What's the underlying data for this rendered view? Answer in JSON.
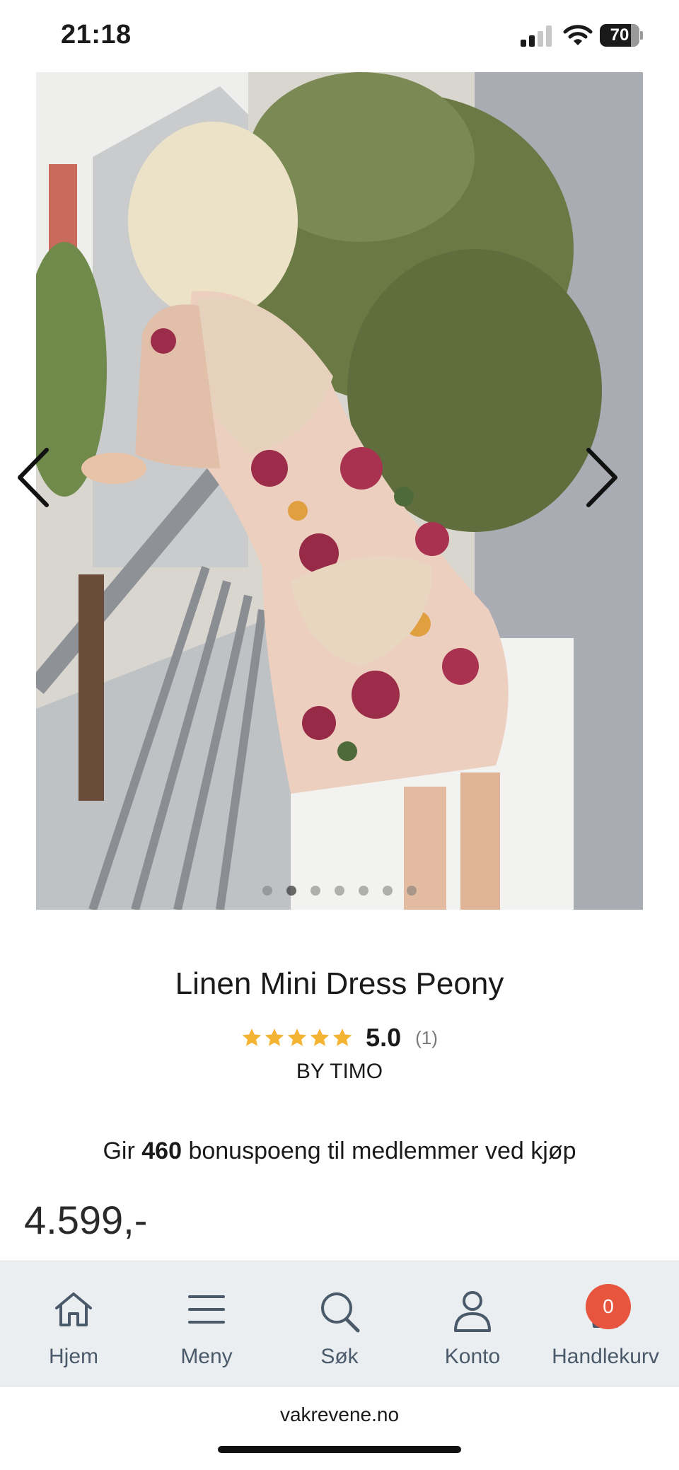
{
  "status_bar": {
    "time": "21:18",
    "battery": "70",
    "signal_bars_active": 2
  },
  "gallery": {
    "image_alt": "Linen Mini Dress Peony",
    "dot_count": 7,
    "active_dot": 1
  },
  "product": {
    "title": "Linen Mini Dress Peony",
    "rating": "5.0",
    "rating_count": "(1)",
    "stars": 5,
    "brand": "BY TIMO",
    "bonus_prefix": "Gir ",
    "bonus_points": "460",
    "bonus_suffix": " bonuspoeng til medlemmer ved kjøp",
    "price": "4.599,-"
  },
  "bottom_nav": {
    "items": [
      {
        "label": "Hjem",
        "icon": "home-icon"
      },
      {
        "label": "Meny",
        "icon": "menu-icon"
      },
      {
        "label": "Søk",
        "icon": "search-icon"
      },
      {
        "label": "Konto",
        "icon": "user-icon"
      },
      {
        "label": "Handlekurv",
        "icon": "cart-icon"
      }
    ],
    "cart_count": "0"
  },
  "browser": {
    "url": "vakrevene.no"
  },
  "colors": {
    "star": "#f5b335",
    "badge": "#e8553e",
    "nav_bg": "#ebeef1",
    "nav_text": "#4a5a6a"
  }
}
